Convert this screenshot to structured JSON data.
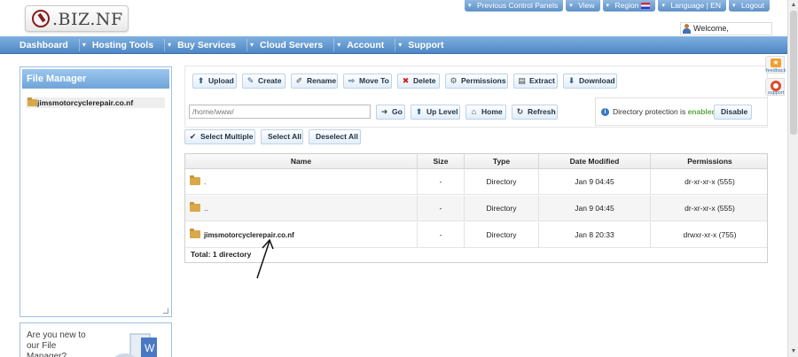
{
  "brand": {
    "logo_text": ".BIZ.NF"
  },
  "toplinks": [
    {
      "label": "Previous Control Panels"
    },
    {
      "label": "View"
    },
    {
      "label": "Region"
    },
    {
      "label": "Language | EN"
    },
    {
      "label": "Logout"
    }
  ],
  "welcome": {
    "label": "Welcome,"
  },
  "nav": [
    {
      "label": "Dashboard"
    },
    {
      "label": "Hosting Tools"
    },
    {
      "label": "Buy Services"
    },
    {
      "label": "Cloud Servers"
    },
    {
      "label": "Account"
    },
    {
      "label": "Support"
    }
  ],
  "file_manager_panel": {
    "title": "File Manager",
    "domain": "jimsmotorcyclerepair.co.nf",
    "promo_text": "Are you new to our File Manager?"
  },
  "toolbar": {
    "upload": "Upload",
    "create": "Create",
    "rename": "Rename",
    "move_to": "Move To",
    "delete": "Delete",
    "permissions": "Permissions",
    "extract": "Extract",
    "download": "Download"
  },
  "path": {
    "value": "/home/www/"
  },
  "navbuttons": {
    "go": "Go",
    "up_level": "Up Level",
    "home": "Home",
    "refresh": "Refresh"
  },
  "protection": {
    "text": "Directory protection is",
    "status": "enabled",
    "disable": "Disable"
  },
  "selection": {
    "select_multiple": "Select Multiple",
    "select_all": "Select All",
    "deselect_all": "Deselect All"
  },
  "table": {
    "headers": [
      "Name",
      "Size",
      "Type",
      "Date Modified",
      "Permissions"
    ],
    "rows": [
      {
        "name": ".",
        "size": "-",
        "type": "Directory",
        "date": "Jan 9 04:45",
        "perms": "dr-xr-xr-x (555)"
      },
      {
        "name": "..",
        "size": "-",
        "type": "Directory",
        "date": "Jan 9 04:45",
        "perms": "dr-xr-xr-x (555)"
      },
      {
        "name": "jimsmotorcyclerepair.co.nf",
        "size": "-",
        "type": "Directory",
        "date": "Jan 8 20:33",
        "perms": "drwxr-xr-x (755)"
      }
    ],
    "total": "Total: 1 directory"
  },
  "side_tabs": {
    "feedback": "feedback",
    "support": "support"
  },
  "colors": {
    "accent": "#5f91c8",
    "enabled": "#5aa63a",
    "delete": "#cc2222"
  }
}
